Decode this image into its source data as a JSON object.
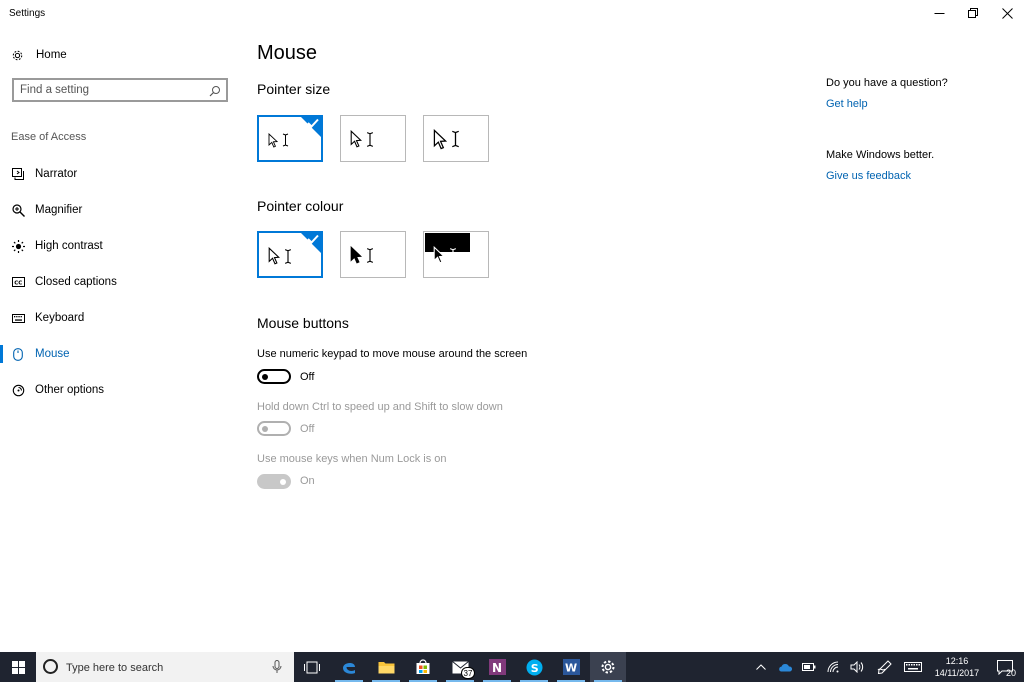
{
  "window": {
    "title": "Settings",
    "minimize_icon": "minimize-icon",
    "restore_icon": "restore-icon",
    "close_icon": "close-icon"
  },
  "sidebar": {
    "home_label": "Home",
    "search_placeholder": "Find a setting",
    "section_label": "Ease of Access",
    "items": [
      {
        "label": "Narrator",
        "icon": "narrator-icon"
      },
      {
        "label": "Magnifier",
        "icon": "magnifier-icon"
      },
      {
        "label": "High contrast",
        "icon": "high-contrast-icon"
      },
      {
        "label": "Closed captions",
        "icon": "closed-captions-icon"
      },
      {
        "label": "Keyboard",
        "icon": "keyboard-icon"
      },
      {
        "label": "Mouse",
        "icon": "mouse-icon",
        "active": true
      },
      {
        "label": "Other options",
        "icon": "other-options-icon"
      }
    ]
  },
  "main": {
    "title": "Mouse",
    "pointer_size": {
      "heading": "Pointer size",
      "selected_index": 0
    },
    "pointer_colour": {
      "heading": "Pointer colour",
      "selected_index": 0
    },
    "mouse_buttons": {
      "heading": "Mouse buttons",
      "options": [
        {
          "label": "Use numeric keypad to move mouse around the screen",
          "state": "Off",
          "enabled": true
        },
        {
          "label": "Hold down Ctrl to speed up and Shift to slow down",
          "state": "Off",
          "enabled": false
        },
        {
          "label": "Use mouse keys when Num Lock is on",
          "state": "On",
          "enabled": false
        }
      ]
    }
  },
  "right_panel": {
    "question": "Do you have a question?",
    "get_help": "Get help",
    "make_better": "Make Windows better.",
    "feedback": "Give us feedback"
  },
  "taskbar": {
    "search_placeholder": "Type here to search",
    "mail_badge": "37",
    "time": "12:16",
    "date": "14/11/2017",
    "notifications_count": "20",
    "colors": {
      "background": "#1f2430",
      "accent": "#0078d7"
    }
  }
}
